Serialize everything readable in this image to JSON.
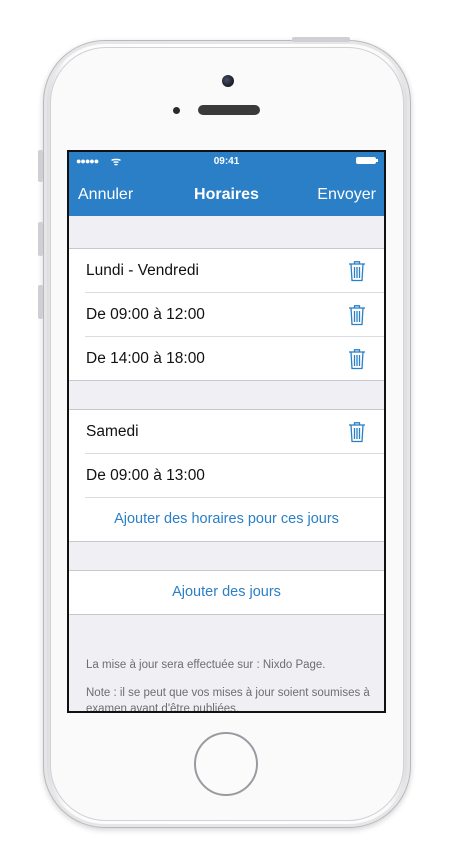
{
  "status_bar": {
    "signal": "●●●●●",
    "wifi": "ᯤ",
    "time": "09:41"
  },
  "navbar": {
    "cancel_label": "Annuler",
    "title": "Horaires",
    "send_label": "Envoyer"
  },
  "groups": [
    {
      "day_label": "Lundi - Vendredi",
      "slots": [
        "De 09:00 à 12:00",
        "De 14:00 à 18:00"
      ]
    },
    {
      "day_label": "Samedi",
      "slots": [
        "De 09:00 à 13:00"
      ],
      "add_hours_label": "Ajouter des horaires pour ces jours"
    }
  ],
  "add_days_label": "Ajouter des jours",
  "footer": {
    "update_note": "La mise à jour sera effectuée sur : Nixdo Page.",
    "review_note": "Note : il se peut que vos mises à jour soient soumises à examen avant d'être publiées."
  },
  "colors": {
    "accent": "#2a7fc6",
    "background": "#efeff4"
  },
  "icons": {
    "delete": "trash-icon"
  }
}
